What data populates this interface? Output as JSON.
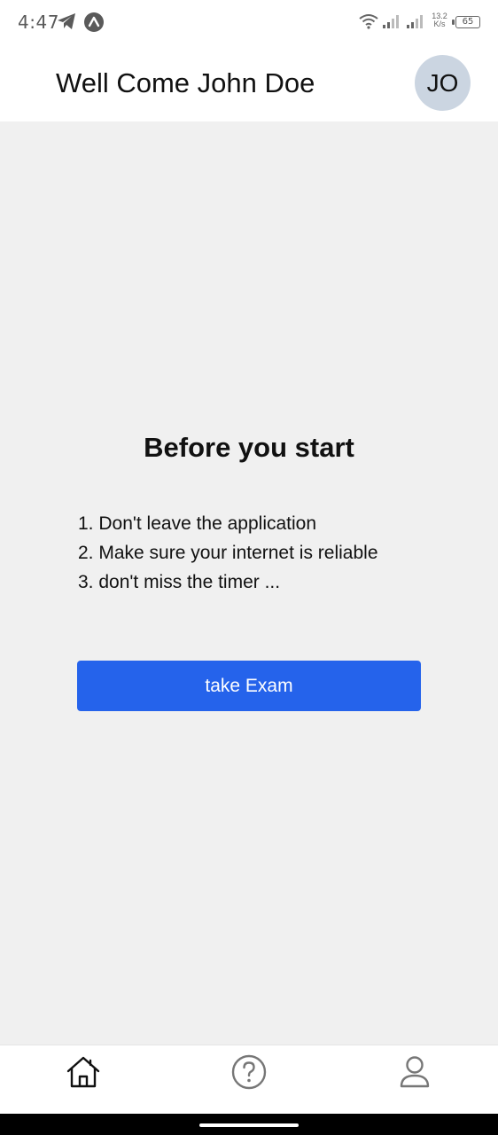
{
  "status_bar": {
    "time": "4:47",
    "speed_value": "13.2",
    "speed_unit": "K/s",
    "battery": "65",
    "icons": [
      "telegram-icon",
      "app-notification-icon",
      "wifi-icon",
      "signal-icon",
      "signal-icon",
      "battery-icon"
    ]
  },
  "header": {
    "title": "Well Come John Doe",
    "avatar_initials": "JO"
  },
  "main": {
    "section_title": "Before you start",
    "rules": [
      "1. Don't leave the application",
      "2. Make sure your internet is reliable",
      "3. don't miss the timer ..."
    ],
    "button_label": "take Exam"
  },
  "bottom_nav": {
    "items": [
      {
        "icon": "home-icon"
      },
      {
        "icon": "help-icon"
      },
      {
        "icon": "user-icon"
      }
    ]
  },
  "colors": {
    "accent": "#2563eb",
    "background": "#f0f0f0",
    "avatar_bg": "#cbd5e1"
  }
}
